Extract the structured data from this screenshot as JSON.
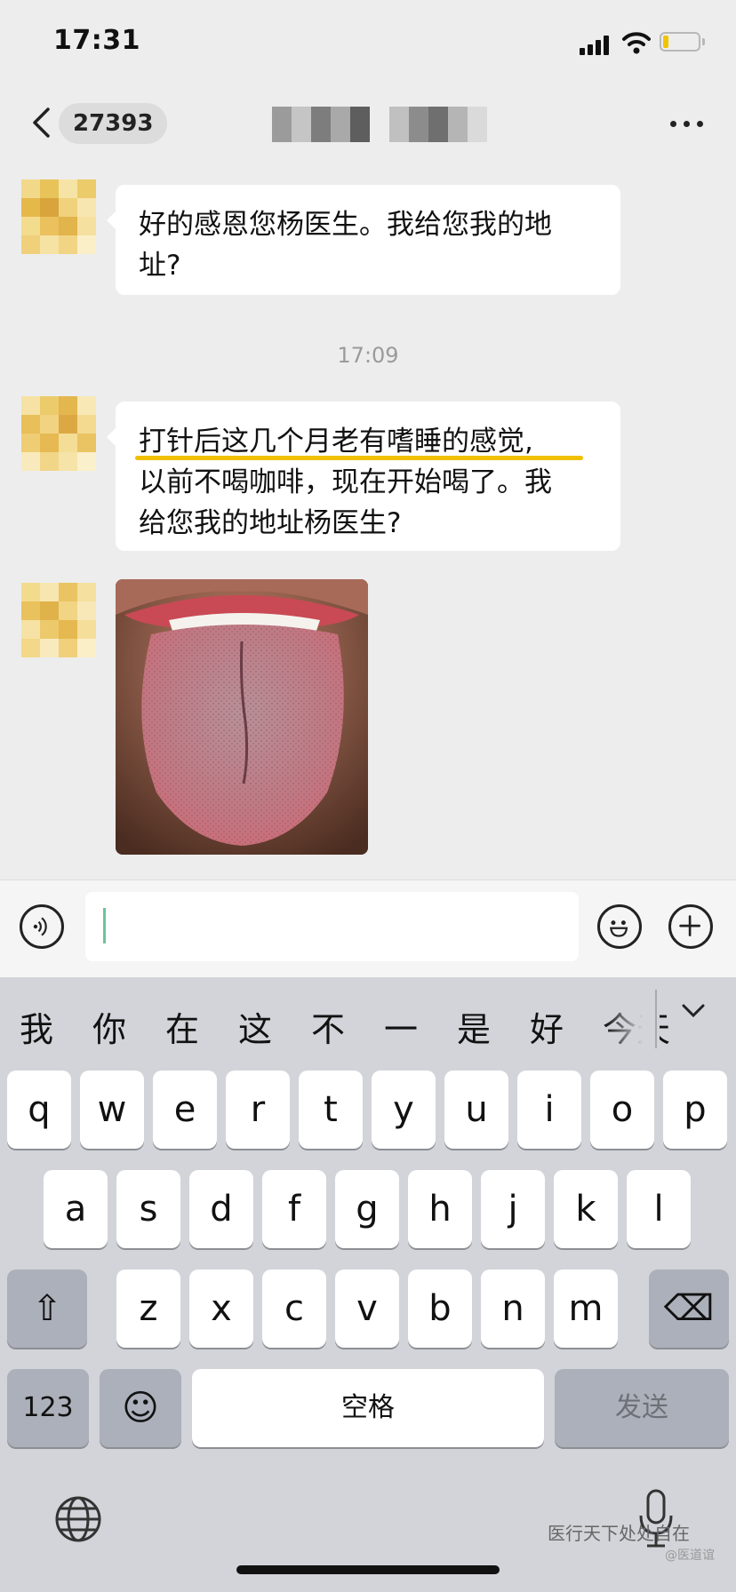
{
  "status_bar": {
    "time": "17:31",
    "battery_color": "#f0c400"
  },
  "nav": {
    "unread_count": "27393",
    "back_icon": "chevron-left-icon",
    "more_icon": "more-dots-icon"
  },
  "messages": [
    {
      "text_line1": "好的感恩您杨医生。我给您我的地",
      "text_line2": "址?"
    },
    {
      "timestamp": "17:09"
    },
    {
      "text_line1": "打针后这几个月老有嗜睡的感觉,",
      "text_line2": "以前不喝咖啡，现在开始喝了。我",
      "text_line3": "给您我的地址杨医生?"
    },
    {
      "image": "tongue-photo"
    }
  ],
  "input_bar": {
    "voice_icon": "voice-icon",
    "emoji_icon": "emoji-icon",
    "add_icon": "plus-icon",
    "value": ""
  },
  "keyboard": {
    "candidates": [
      "我",
      "你",
      "在",
      "这",
      "不",
      "一",
      "是",
      "好",
      "今天"
    ],
    "row1": [
      "q",
      "w",
      "e",
      "r",
      "t",
      "y",
      "u",
      "i",
      "o",
      "p"
    ],
    "row2": [
      "a",
      "s",
      "d",
      "f",
      "g",
      "h",
      "j",
      "k",
      "l"
    ],
    "row3": [
      "z",
      "x",
      "c",
      "v",
      "b",
      "n",
      "m"
    ],
    "shift_glyph": "⇧",
    "delete_glyph": "⌫",
    "numbers_label": "123",
    "emoji_glyph": "☺",
    "space_label": "空格",
    "send_label": "发送"
  },
  "watermark": {
    "line1": "医行天下处处自在",
    "line2": "@医道谊"
  }
}
